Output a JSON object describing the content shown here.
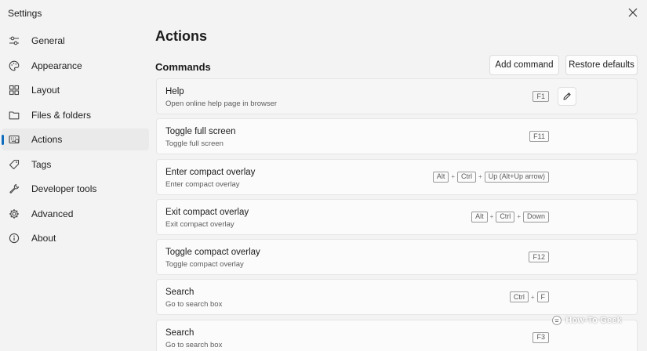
{
  "window": {
    "title": "Settings"
  },
  "sidebar": {
    "items": [
      {
        "label": "General",
        "icon": "sliders-icon"
      },
      {
        "label": "Appearance",
        "icon": "palette-icon"
      },
      {
        "label": "Layout",
        "icon": "grid-icon"
      },
      {
        "label": "Files & folders",
        "icon": "folder-icon"
      },
      {
        "label": "Actions",
        "icon": "keyboard-icon",
        "active": true
      },
      {
        "label": "Tags",
        "icon": "tag-icon"
      },
      {
        "label": "Developer tools",
        "icon": "wrench-icon"
      },
      {
        "label": "Advanced",
        "icon": "gear-icon"
      },
      {
        "label": "About",
        "icon": "info-icon"
      }
    ]
  },
  "main": {
    "title": "Actions",
    "section_title": "Commands",
    "add_command_label": "Add command",
    "restore_defaults_label": "Restore defaults",
    "commands": [
      {
        "name": "Help",
        "description": "Open online help page in browser",
        "keys": [
          "F1"
        ]
      },
      {
        "name": "Toggle full screen",
        "description": "Toggle full screen",
        "keys": [
          "F11"
        ]
      },
      {
        "name": "Enter compact overlay",
        "description": "Enter compact overlay",
        "keys": [
          "Alt",
          "Ctrl",
          "Up (Alt+Up arrow)"
        ]
      },
      {
        "name": "Exit compact overlay",
        "description": "Exit compact overlay",
        "keys": [
          "Alt",
          "Ctrl",
          "Down"
        ]
      },
      {
        "name": "Toggle compact overlay",
        "description": "Toggle compact overlay",
        "keys": [
          "F12"
        ]
      },
      {
        "name": "Search",
        "description": "Go to search box",
        "keys": [
          "Ctrl",
          "F"
        ]
      },
      {
        "name": "Search",
        "description": "Go to search box",
        "keys": [
          "F3"
        ]
      }
    ],
    "key_separator": "+"
  },
  "watermark": {
    "text": "How-To Geek"
  },
  "colors": {
    "accent": "#0f6cbd",
    "background": "#f3f3f3",
    "card": "#fbfbfb"
  }
}
